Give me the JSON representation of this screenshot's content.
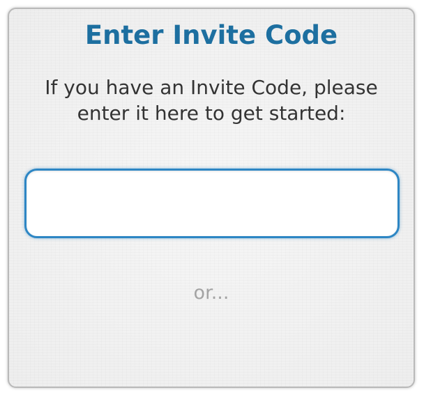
{
  "dialog": {
    "title": "Enter Invite Code",
    "instructions": "If you have an Invite Code, please enter it here to get started:",
    "invite_input": {
      "value": "",
      "placeholder": ""
    },
    "or_text": "or..."
  },
  "colors": {
    "title": "#1d6fa0",
    "body_text": "#333333",
    "input_border": "#2d86c4",
    "or_text": "#a3a3a3",
    "panel_background": "#f1f1f1"
  }
}
